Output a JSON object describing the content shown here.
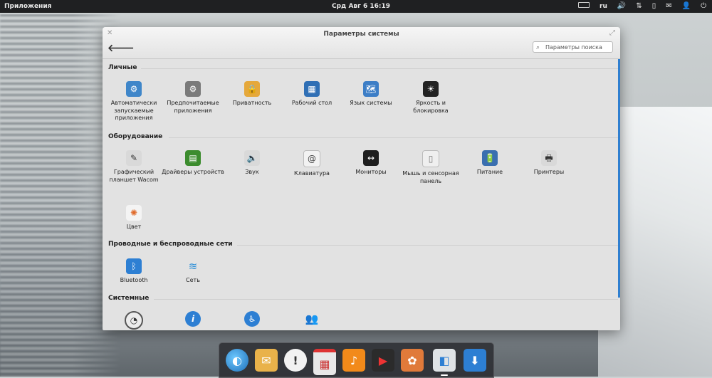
{
  "panel": {
    "apps_label": "Приложения",
    "clock": "Срд Авг  6 16:19",
    "lang": "ru"
  },
  "window": {
    "title": "Параметры системы",
    "search_placeholder": "Параметры поиска"
  },
  "sections": [
    {
      "title": "Личные",
      "items": [
        {
          "label": "Автоматически запускаемые приложения",
          "icon": "autostart-apps-icon"
        },
        {
          "label": "Предпочитаемые приложения",
          "icon": "default-apps-icon"
        },
        {
          "label": "Приватность",
          "icon": "padlock-icon"
        },
        {
          "label": "Рабочий стол",
          "icon": "desktop-icon"
        },
        {
          "label": "Язык системы",
          "icon": "language-icon"
        },
        {
          "label": "Яркость и блокировка",
          "icon": "brightness-icon"
        }
      ]
    },
    {
      "title": "Оборудование",
      "items": [
        {
          "label": "Графический планшет Wacom",
          "icon": "tablet-pen-icon"
        },
        {
          "label": "Драйверы устройств",
          "icon": "chip-board-icon"
        },
        {
          "label": "Звук",
          "icon": "speaker-icon"
        },
        {
          "label": "Клавиатура",
          "icon": "keyboard-icon"
        },
        {
          "label": "Мониторы",
          "icon": "monitor-icon"
        },
        {
          "label": "Мышь и сенсорная панель",
          "icon": "mouse-icon"
        },
        {
          "label": "Питание",
          "icon": "battery-icon"
        },
        {
          "label": "Принтеры",
          "icon": "printer-icon"
        },
        {
          "label": "Цвет",
          "icon": "color-wheel-icon"
        }
      ]
    },
    {
      "title": "Проводные и беспроводные сети",
      "items": [
        {
          "label": "Bluetooth",
          "icon": "bluetooth-icon"
        },
        {
          "label": "Сеть",
          "icon": "wifi-icon"
        }
      ]
    },
    {
      "title": "Системные",
      "items": [
        {
          "label": "",
          "icon": "clock-icon"
        },
        {
          "label": "",
          "icon": "info-icon"
        },
        {
          "label": "",
          "icon": "accessibility-icon"
        },
        {
          "label": "",
          "icon": "users-icon"
        }
      ]
    }
  ],
  "dock": [
    {
      "icon": "browser-icon",
      "color": "#2a8fd6"
    },
    {
      "icon": "mail-icon",
      "color": "#e9b24a"
    },
    {
      "icon": "chat-bubble-icon",
      "color": "#f2f2f2"
    },
    {
      "icon": "calendar-icon",
      "color": "#e8e8e8"
    },
    {
      "icon": "music-note-icon",
      "color": "#f28a1a"
    },
    {
      "icon": "video-icon",
      "color": "#c62c2c"
    },
    {
      "icon": "photos-icon",
      "color": "#e07a3a"
    },
    {
      "icon": "settings-switch-icon",
      "color": "#dfe3e6"
    },
    {
      "icon": "download-icon",
      "color": "#2d7fd3"
    }
  ]
}
